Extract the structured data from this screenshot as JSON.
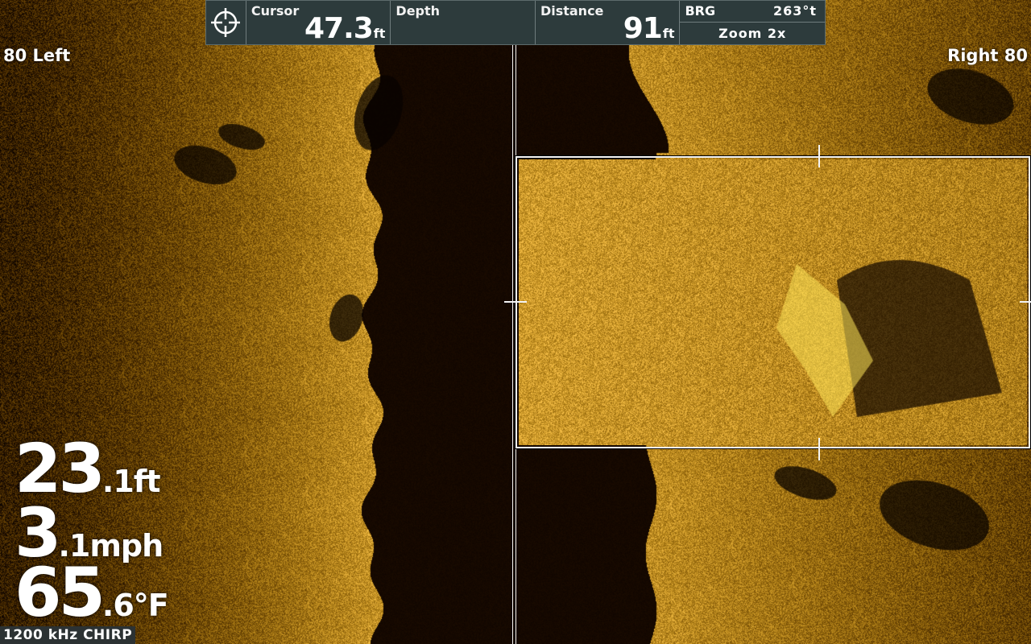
{
  "topbar": {
    "cursor": {
      "label": "Cursor",
      "value": "47.3",
      "unit": "ft"
    },
    "depth": {
      "label": "Depth",
      "value": "",
      "unit": ""
    },
    "distance": {
      "label": "Distance",
      "value": "91",
      "unit": "ft"
    },
    "bearing": {
      "label": "BRG",
      "value": "263°t"
    },
    "zoom": {
      "label": "Zoom 2x"
    }
  },
  "range": {
    "left": "80 Left",
    "right": "Right 80"
  },
  "readouts": {
    "depth": {
      "big": "23",
      "small": ".1ft"
    },
    "speed": {
      "big": "3",
      "small": ".1mph"
    },
    "temperature": {
      "big": "65",
      "small": ".6°F"
    }
  },
  "frequency": "1200 kHz CHIRP",
  "colors": {
    "sonar_bright": "#e9b51c",
    "sonar_dark": "#0c0400",
    "bar_bg": "#2d3b3c"
  },
  "icons": {
    "target": "crosshair-target-icon"
  }
}
